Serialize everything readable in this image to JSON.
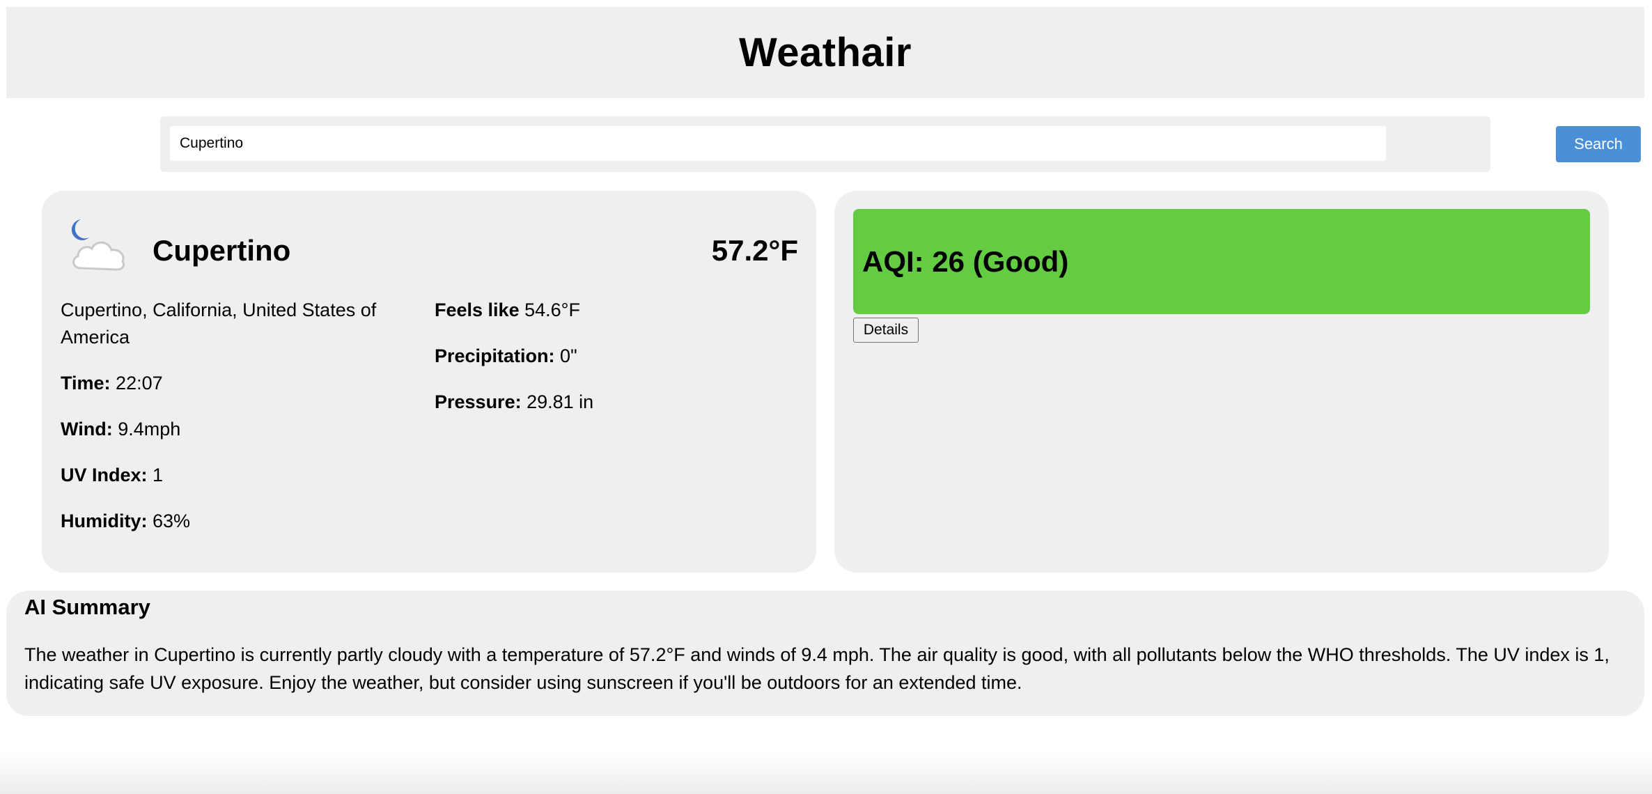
{
  "header": {
    "title": "Weathair"
  },
  "search": {
    "value": "Cupertino",
    "button_label": "Search"
  },
  "weather": {
    "icon": "partly-cloudy-night-icon",
    "city": "Cupertino",
    "temperature": "57.2°F",
    "location": "Cupertino, California, United States of America",
    "time_label": "Time:",
    "time_value": "22:07",
    "wind_label": "Wind:",
    "wind_value": "9.4mph",
    "uv_label": "UV Index:",
    "uv_value": "1",
    "humidity_label": "Humidity:",
    "humidity_value": "63%",
    "feels_label": "Feels like",
    "feels_value": "54.6°F",
    "precip_label": "Precipitation:",
    "precip_value": "0\"",
    "pressure_label": "Pressure:",
    "pressure_value": "29.81 in"
  },
  "aqi": {
    "text": "AQI: 26 (Good)",
    "color": "#63cc43",
    "details_label": "Details"
  },
  "summary": {
    "title": "AI Summary",
    "text": "The weather in Cupertino is currently partly cloudy with a temperature of 57.2°F and winds of 9.4 mph. The air quality is good, with all pollutants below the WHO thresholds. The UV index is 1, indicating safe UV exposure. Enjoy the weather, but consider using sunscreen if you'll be outdoors for an extended time."
  },
  "colors": {
    "panel": "#efefef",
    "search_button": "#4a90d9",
    "aqi_good": "#63cc43"
  }
}
